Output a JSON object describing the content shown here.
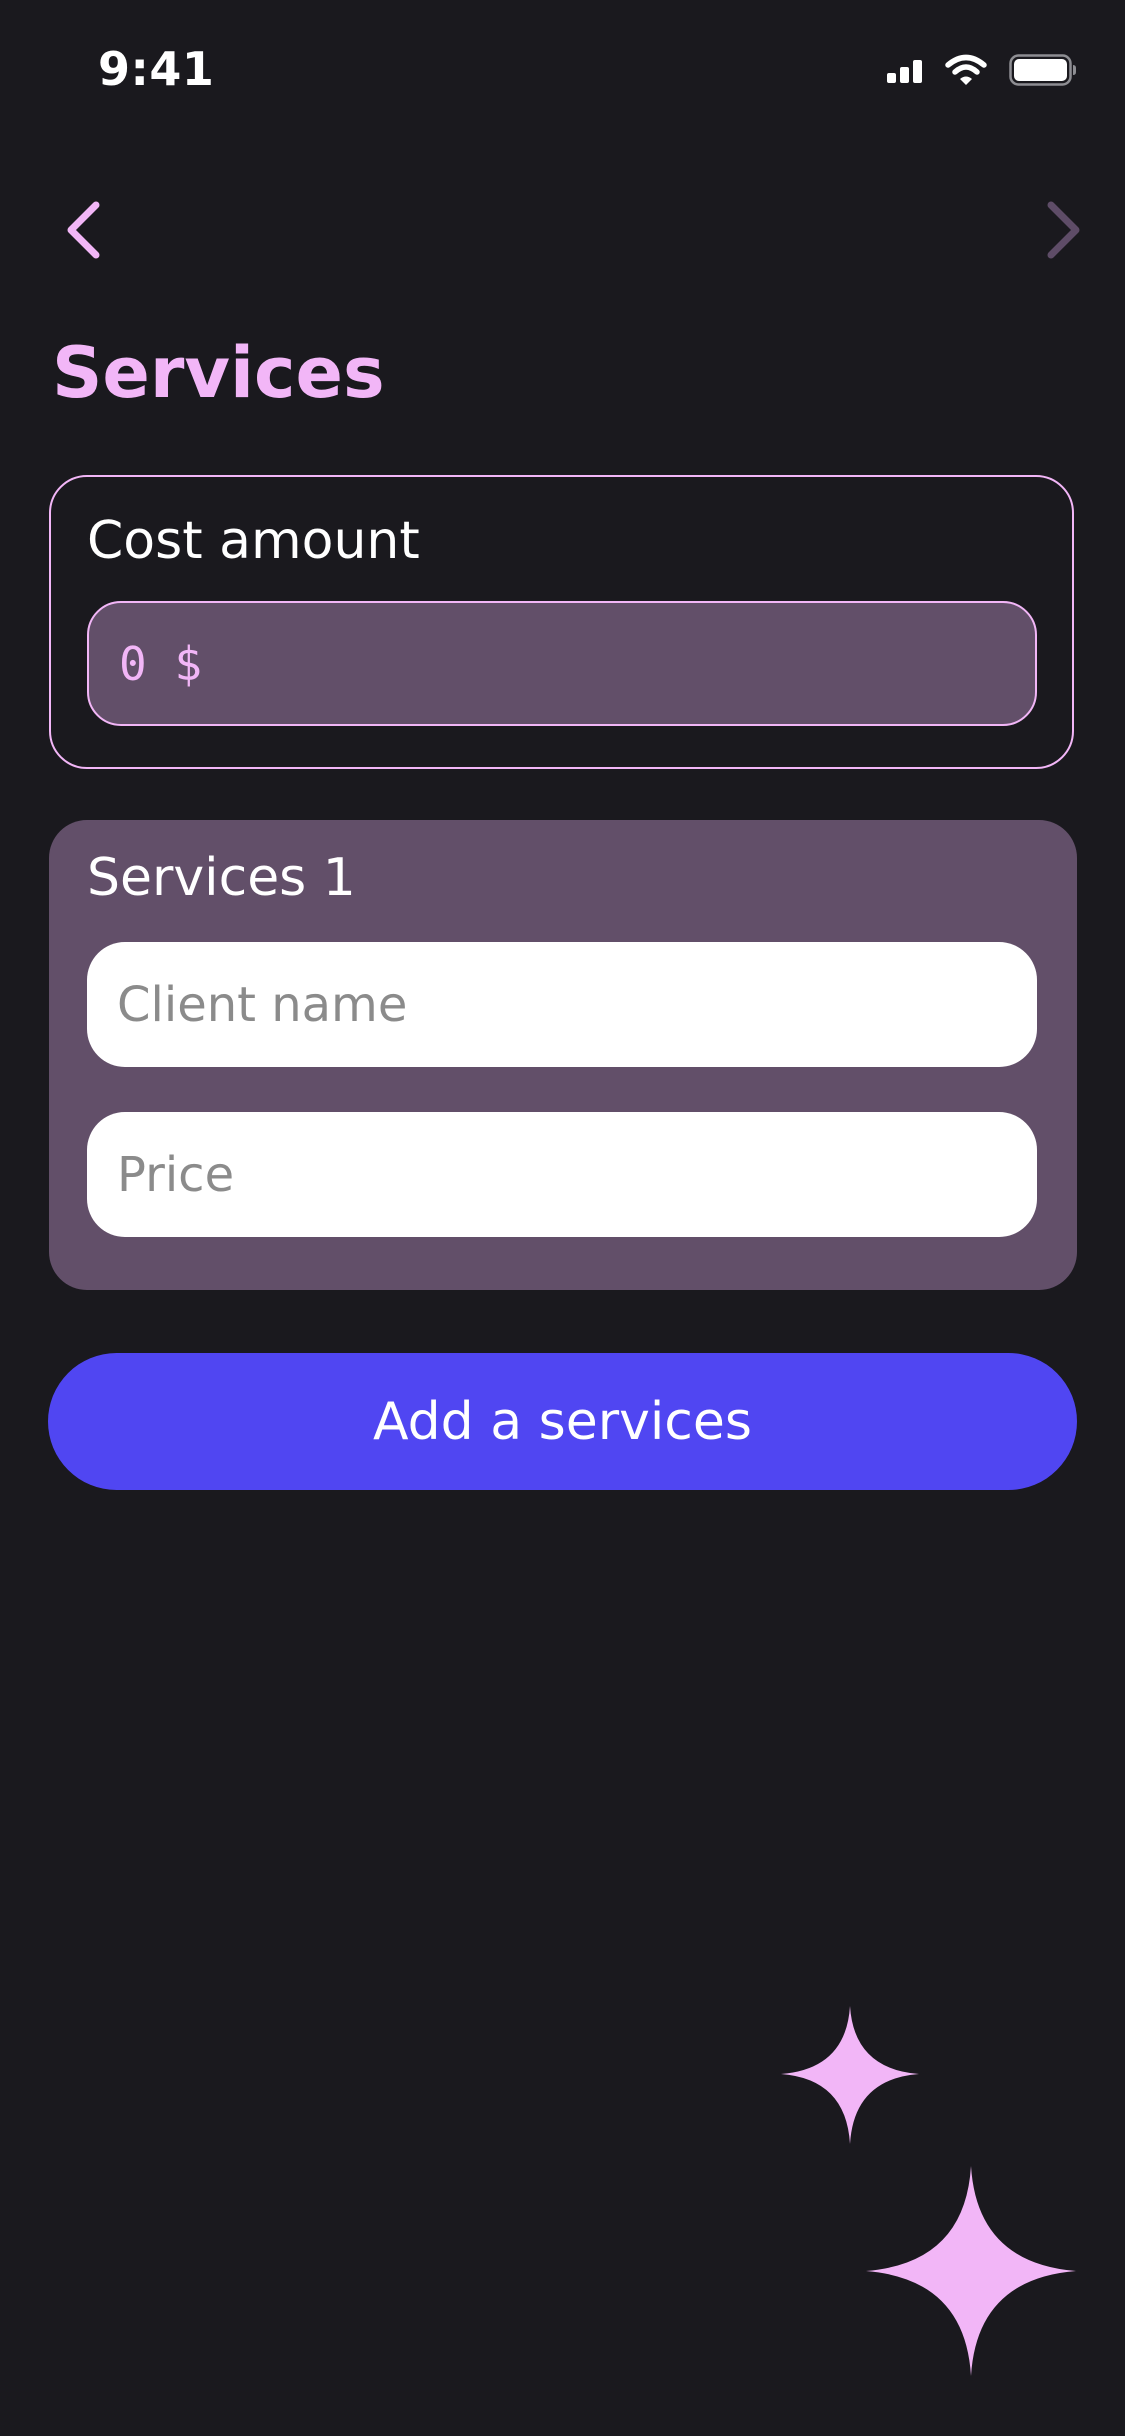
{
  "status_bar": {
    "time": "9:41",
    "icons": [
      "cellular-signal-icon",
      "wifi-icon",
      "battery-icon"
    ]
  },
  "nav": {
    "back_icon": "chevron-left-icon",
    "forward_icon": "chevron-right-icon"
  },
  "page": {
    "title": "Services"
  },
  "cost": {
    "label": "Cost amount",
    "value": "0 $"
  },
  "services": [
    {
      "title": "Services 1",
      "client_placeholder": "Client name",
      "price_placeholder": "Price"
    }
  ],
  "actions": {
    "add_label": "Add a services"
  },
  "decorations": [
    "sparkle-icon",
    "sparkle-icon"
  ],
  "colors": {
    "background": "#1a191e",
    "accent_pink": "#f2b6f7",
    "card_purple": "#624f69",
    "button_blue": "#5046f2",
    "forward_disabled": "#5e4c67"
  }
}
